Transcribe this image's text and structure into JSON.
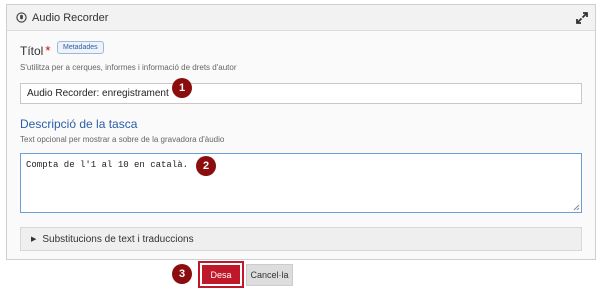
{
  "panel": {
    "title": "Audio Recorder",
    "title_icon": "microphone-icon",
    "expand_icon": "expand-icon"
  },
  "title_field": {
    "label": "Títol",
    "required_mark": "*",
    "badge": "Metadades",
    "help": "S'utilitza per a cerques, informes i informació de drets d'autor",
    "value": "Audio Recorder: enregistrament"
  },
  "description": {
    "label": "Descripció de la tasca",
    "help": "Text opcional per mostrar a sobre de la gravadora d'àudio",
    "value": "Compta de l'1 al 10 en català."
  },
  "accordion": {
    "label": "Substitucions de text i traduccions",
    "icon": "caret-right-icon"
  },
  "buttons": {
    "save": "Desa",
    "cancel": "Cancel·la"
  },
  "markers": [
    "1",
    "2",
    "3"
  ],
  "colors": {
    "accent": "#2a5fa8",
    "marker": "#8b0d0d",
    "save": "#c0182b"
  }
}
